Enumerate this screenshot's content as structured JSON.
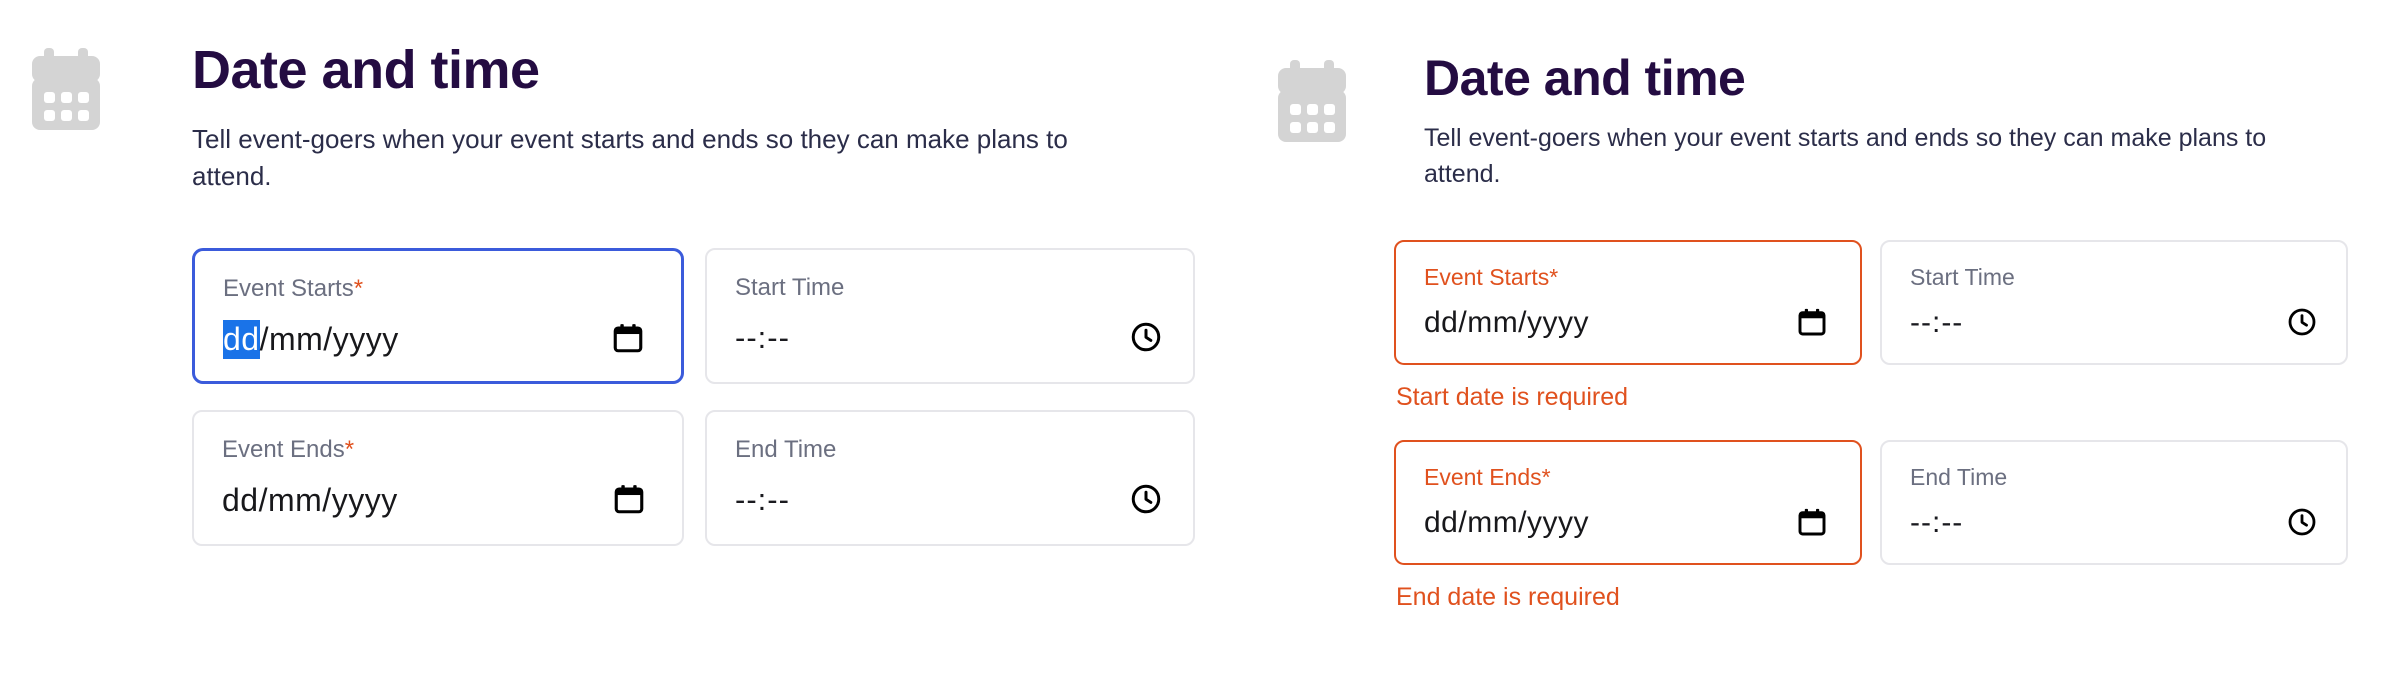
{
  "panels": [
    {
      "state": "focused",
      "icon": "calendar-illustration-icon",
      "title": "Date and time",
      "description": "Tell event-goers when your event starts and ends so they can make plans to attend.",
      "fields": [
        {
          "name": "event-starts",
          "label": "Event Starts",
          "required_marker": "*",
          "value_selected": "dd",
          "value_rest": "/mm/yyyy",
          "placeholder": "dd/mm/yyyy",
          "icon": "calendar-picker-icon",
          "state": "focused",
          "error": ""
        },
        {
          "name": "start-time",
          "label": "Start Time",
          "required_marker": "",
          "value": "--:--",
          "placeholder": "--:--",
          "icon": "clock-picker-icon",
          "state": "default",
          "error": ""
        },
        {
          "name": "event-ends",
          "label": "Event Ends",
          "required_marker": "*",
          "value": "dd/mm/yyyy",
          "placeholder": "dd/mm/yyyy",
          "icon": "calendar-picker-icon",
          "state": "default",
          "error": ""
        },
        {
          "name": "end-time",
          "label": "End Time",
          "required_marker": "",
          "value": "--:--",
          "placeholder": "--:--",
          "icon": "clock-picker-icon",
          "state": "default",
          "error": ""
        }
      ]
    },
    {
      "state": "error",
      "icon": "calendar-illustration-icon",
      "title": "Date and time",
      "description": "Tell event-goers when your event starts and ends so they can make plans to attend.",
      "fields": [
        {
          "name": "event-starts",
          "label": "Event Starts",
          "required_marker": "*",
          "value": "dd/mm/yyyy",
          "placeholder": "dd/mm/yyyy",
          "icon": "calendar-picker-icon",
          "state": "error",
          "error": "Start date is required"
        },
        {
          "name": "start-time",
          "label": "Start Time",
          "required_marker": "",
          "value": "--:--",
          "placeholder": "--:--",
          "icon": "clock-picker-icon",
          "state": "default",
          "error": ""
        },
        {
          "name": "event-ends",
          "label": "Event Ends",
          "required_marker": "*",
          "value": "dd/mm/yyyy",
          "placeholder": "dd/mm/yyyy",
          "icon": "calendar-picker-icon",
          "state": "error",
          "error": "End date is required"
        },
        {
          "name": "end-time",
          "label": "End Time",
          "required_marker": "",
          "value": "--:--",
          "placeholder": "--:--",
          "icon": "clock-picker-icon",
          "state": "default",
          "error": ""
        }
      ]
    }
  ],
  "colors": {
    "title": "#240c42",
    "description": "#2b2d49",
    "label_default": "#6b6f80",
    "label_error": "#e0511e",
    "border_default": "#e6e6ea",
    "border_focus": "#3b5bdb",
    "border_error": "#e0511e",
    "error_text": "#e0511e",
    "selection_bg": "#1a73e8",
    "required_star": "#e0511e",
    "illustration": "#d4d4d4",
    "value_text": "#18181b",
    "background": "#ffffff"
  }
}
